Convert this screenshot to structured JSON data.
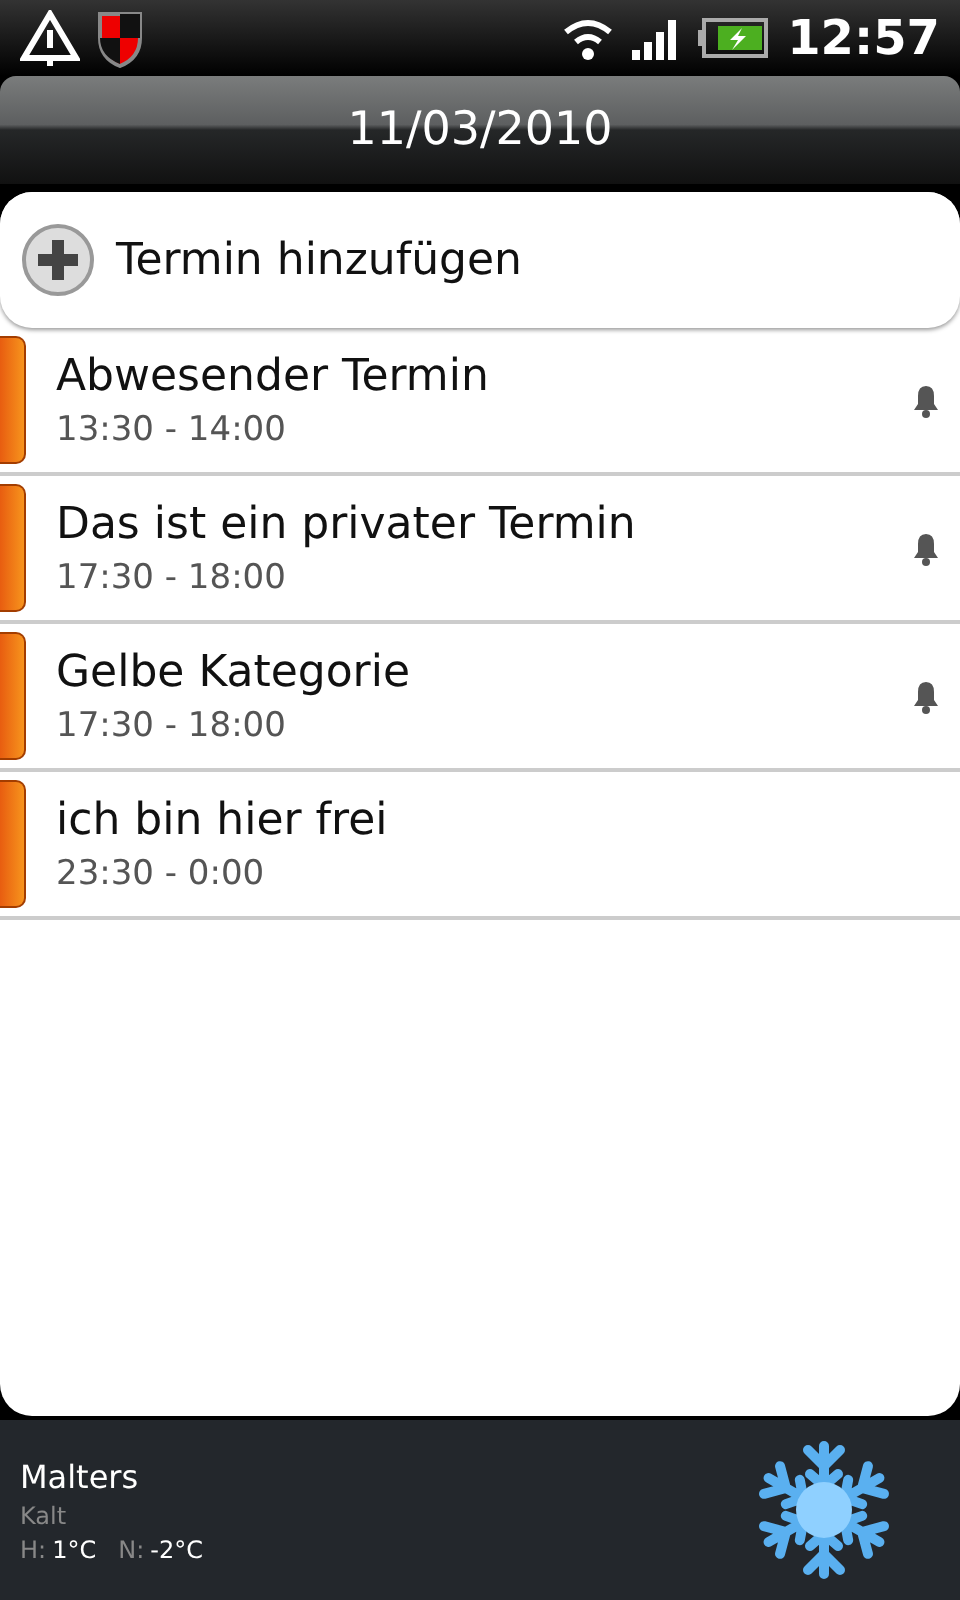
{
  "status_bar": {
    "time": "12:57"
  },
  "header": {
    "date": "11/03/2010"
  },
  "add_button": {
    "label": "Termin hinzufügen"
  },
  "events": [
    {
      "title": "Abwesender Termin",
      "time": "13:30 - 14:00",
      "alarm": true
    },
    {
      "title": "Das ist ein privater Termin",
      "time": "17:30 - 18:00",
      "alarm": true
    },
    {
      "title": "Gelbe Kategorie",
      "time": "17:30 - 18:00",
      "alarm": true
    },
    {
      "title": "ich bin hier frei",
      "time": "23:30 - 0:00",
      "alarm": false
    }
  ],
  "weather": {
    "city": "Malters",
    "condition": "Kalt",
    "high_label": "H:",
    "high": "1°C",
    "low_label": "N:",
    "low": "-2°C"
  }
}
